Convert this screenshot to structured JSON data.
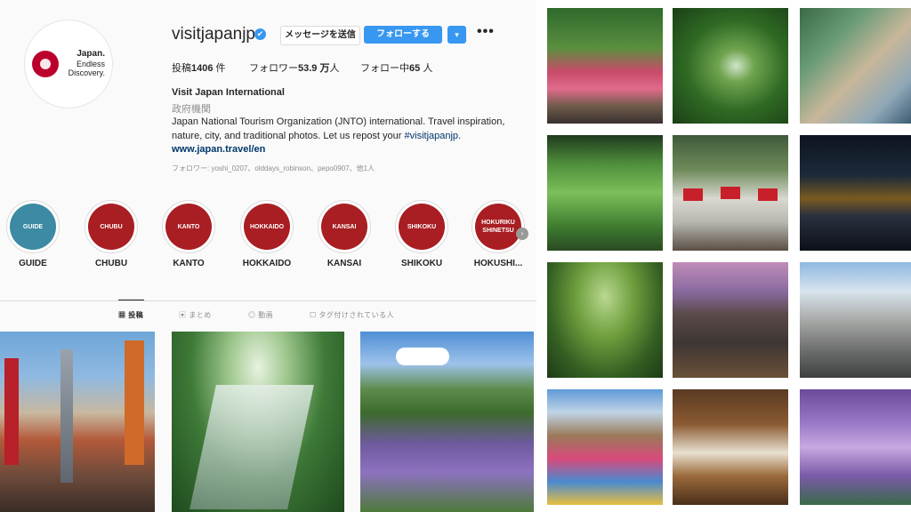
{
  "profile": {
    "avatar": {
      "line1": "Japan.",
      "line2": "Endless",
      "line3": "Discovery."
    },
    "username": "visitjapanjp",
    "verified_icon": "✔",
    "message_button": "メッセージを送信",
    "follow_button": "フォローする",
    "dropdown_icon": "▾",
    "more_icon": "•••",
    "stats": {
      "posts_label": "投稿",
      "posts_value": "1406",
      "posts_unit": "件",
      "followers_label": "フォロワー",
      "followers_value": "53.9 万",
      "followers_unit": "人",
      "following_label": "フォロー中",
      "following_value": "65",
      "following_unit": "人"
    },
    "full_name": "Visit Japan International",
    "category": "政府機関",
    "bio_line": "Japan National Tourism Organization (JNTO) international. Travel inspiration, nature, city, and traditional photos. Let us repost your",
    "bio_hashtag": "#visitjapanjp",
    "bio_end": ".",
    "website": "www.japan.travel/en",
    "followed_by": "フォロワー: yoshi_0207、olddays_robinson、pepo0907、他1人"
  },
  "highlights": [
    {
      "circle": "GUIDE",
      "label": "GUIDE"
    },
    {
      "circle": "CHUBU",
      "label": "CHUBU"
    },
    {
      "circle": "KANTO",
      "label": "KANTO"
    },
    {
      "circle": "HOKKAIDO",
      "label": "HOKKAIDO"
    },
    {
      "circle": "KANSAI",
      "label": "KANSAI"
    },
    {
      "circle": "SHIKOKU",
      "label": "SHIKOKU"
    },
    {
      "circle": "HOKURIKU SHINETSU",
      "label": "HOKUSHI..."
    }
  ],
  "highlights_arrow_icon": "›",
  "tabs": [
    {
      "icon": "▦",
      "label": "投稿"
    },
    {
      "icon": "▣",
      "label": "まとめ"
    },
    {
      "icon": "◎",
      "label": "動画"
    },
    {
      "icon": "☐",
      "label": "タグ付けされている人"
    }
  ],
  "colors": {
    "accent": "#3897f0",
    "highlight": "#a81e22",
    "guide": "#3c8aa3"
  }
}
